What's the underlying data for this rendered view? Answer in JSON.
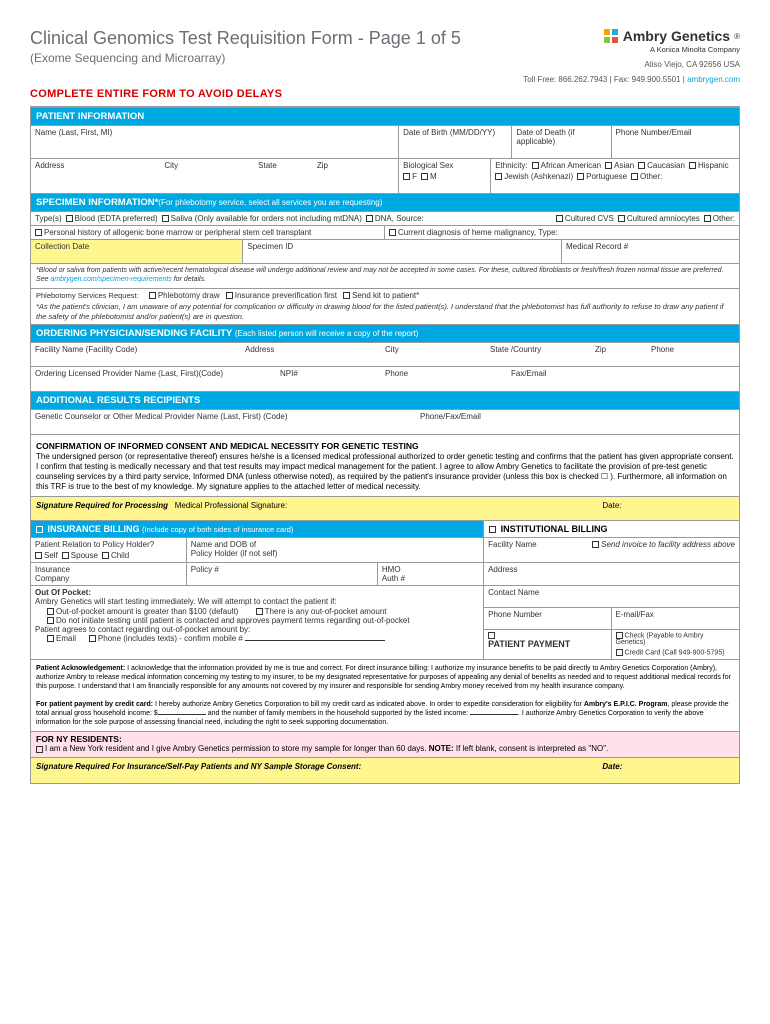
{
  "header": {
    "title": "Clinical Genomics Test Requisition Form - Page 1 of 5",
    "subtitle": "(Exome Sequencing and Microarray)",
    "warning": "COMPLETE ENTIRE FORM TO AVOID DELAYS",
    "company_name": "Ambry Genetics",
    "company_tagline": "A Konica Minolta Company",
    "address": "Aliso Viejo, CA 92656 USA",
    "contact": "Toll Free: 866.262.7943  |  Fax: 949.900.5501  |  ",
    "site": "ambrygen.com"
  },
  "patient": {
    "bar": "PATIENT INFORMATION",
    "name": "Name (Last, First, MI)",
    "dob": "Date of Birth (MM/DD/YY)",
    "dod": "Date of Death (if applicable)",
    "phone": "Phone Number/Email",
    "address": "Address",
    "city": "City",
    "state": "State",
    "zip": "Zip",
    "bio_sex": "Biological Sex",
    "sex_f": "F",
    "sex_m": "M",
    "ethnicity": "Ethnicity:",
    "eth": [
      "African American",
      "Asian",
      "Caucasian",
      "Hispanic",
      "Jewish (Ashkenazi)",
      "Portuguese",
      "Other:"
    ]
  },
  "specimen": {
    "bar": "SPECIMEN INFORMATION*",
    "bar_note": "(For phlebotomy service, select all services you are requesting)",
    "types_label": "Type(s)",
    "blood": "Blood (EDTA preferred)",
    "saliva": "Saliva (Only available for orders not including mtDNA)",
    "dna": "DNA, Source:",
    "cvs": "Cultured CVS",
    "amnio": "Cultured amniocytes",
    "other": "Other:",
    "history": "Personal history of allogenic bone marrow or peripheral stem cell transplant",
    "heme": "Current diagnosis of heme malignancy, Type:",
    "collection_date": "Collection Date",
    "specimen_id": "Specimen ID",
    "mrn": "Medical Record #",
    "fine": "*Blood or saliva from patients with active/recent hematological disease will undergo additional review and may not be accepted in some cases. For these, cultured fibroblasts or fresh/fresh frozen normal tissue are preferred. See ",
    "fine_link": "ambrygen.com/specimen-requirements",
    "fine_tail": " for details.",
    "phleb_label": "Phlebotomy Services Request:",
    "phleb_opts": [
      "Phlebotomy draw",
      "Insurance preverification first",
      "Send kit to patient*"
    ],
    "phleb_disc": "*As the patient's clinician, I am unaware of any potential for complication or difficulty in drawing blood for the listed patient(s). I understand that the phlebotomist has full authority to refuse to draw any patient if the safety of the phlebotomist and/or patient(s) are in question."
  },
  "ordering": {
    "bar": "ORDERING PHYSICIAN/SENDING FACILITY",
    "bar_note": "(Each listed person will receive a copy of the report)",
    "facility": "Facility Name (Facility Code)",
    "addr": "Address",
    "city": "City",
    "state": "State /Country",
    "zip": "Zip",
    "phone": "Phone",
    "provider": "Ordering Licensed Provider Name (Last, First)(Code)",
    "npi": "NPI#",
    "pphone": "Phone",
    "fax": "Fax/Email"
  },
  "additional": {
    "bar": "ADDITIONAL RESULTS RECIPIENTS",
    "line": "Genetic Counselor or Other Medical Provider Name (Last, First) (Code)",
    "contact": "Phone/Fax/Email"
  },
  "consent": {
    "title": "CONFIRMATION OF INFORMED CONSENT AND MEDICAL NECESSITY FOR GENETIC TESTING",
    "body": "The undersigned person (or representative thereof) ensures he/she is a licensed medical professional authorized to order genetic testing and confirms that the patient has given appropriate consent. I confirm that testing is medically necessary and that test results may impact medical management for the patient. I agree to allow Ambry Genetics to facilitate the provision of pre-test genetic counseling services by a third party service, Informed DNA (unless otherwise noted), as required by the patient's insurance provider (unless this box is checked ☐ ). Furthermore, all information on this TRF is true to the best of my knowledge. My signature applies to the attached letter of medical necessity.",
    "sig_req": "Signature Required for Processing",
    "sig_label": "Medical Professional Signature:",
    "date": "Date:"
  },
  "billing": {
    "ins_bar": "INSURANCE BILLING",
    "ins_note": "(Include copy of both sides of insurance card)",
    "inst_bar": "INSTITUTIONAL BILLING",
    "relation": "Patient Relation to Policy Holder?",
    "rel_opts": [
      "Self",
      "Spouse",
      "Child"
    ],
    "holder": "Name and DOB of",
    "holder2": "Policy Holder (if not self)",
    "facility": "Facility Name",
    "send_inv": "Send invoice to facility address above",
    "ins_co": "Insurance",
    "ins_co2": "Company",
    "policy": "Policy #",
    "hmo": "HMO",
    "auth": "Auth #",
    "address": "Address",
    "oop_title": "Out Of Pocket:",
    "oop1": "Ambry Genetics will start testing immediately. We will attempt to contact the patient if:",
    "oop_a": "Out-of-pocket amount is greater than $100 (default)",
    "oop_b": "There is any out-of-pocket amount",
    "oop_c": "Do not initiate testing until patient is contacted and approves payment terms regarding out-of-pocket",
    "oop2": "Patient agrees to contact regarding out-of-pocket amount by:",
    "oop_email": "Email",
    "oop_phone": "Phone (includes texts) - confirm mobile # ",
    "contact_name": "Contact Name",
    "phone": "Phone Number",
    "emailfax": "E-mail/Fax",
    "patient_pay": "PATIENT PAYMENT",
    "check": "Check (Payable to Ambry Genetics)",
    "cc": "Credit Card (Call 949-900-5795)"
  },
  "ack": {
    "p1a": "Patient Acknowledgement:",
    "p1": " I acknowledge that the information provided by me is true and correct. For direct insurance billing: I authorize my insurance benefits to be paid directly to Ambry Genetics Corporation (Ambry), authorize Ambry to release medical information concerning my testing to my insurer, to be my designated representative for purposes of appealing any denial of benefits as needed and to request additional medical records for this purpose. I understand that I am financially responsible for any amounts not covered by my insurer and responsible for sending Ambry money received from my health insurance company.",
    "p2a": "For patient payment by credit card:",
    "p2": " I hereby authorize Ambry Genetics Corporation to bill my credit card as indicated above. In order to expedite consideration for eligibility for ",
    "p2b": "Ambry's E.P.I.C. Program",
    "p2c": ", please provide the total annual gross household income: $",
    "p2d": " and the number of family members in the household supported by the listed income: ",
    "p2e": ". I authorize Ambry Genetics Corporation to verify the above information for the sole purpose of assessing financial need, including the right to seek supporting documentation."
  },
  "ny": {
    "title": "FOR NY RESIDENTS:",
    "body": "I am a New York resident and I give Ambry Genetics permission to store my sample for longer than 60 days. ",
    "note_b": "NOTE:",
    "note": " If left blank, consent is interpreted as \"NO\"."
  },
  "sig2": {
    "label": "Signature Required For Insurance/Self-Pay Patients and NY Sample Storage Consent:",
    "date": "Date:"
  }
}
